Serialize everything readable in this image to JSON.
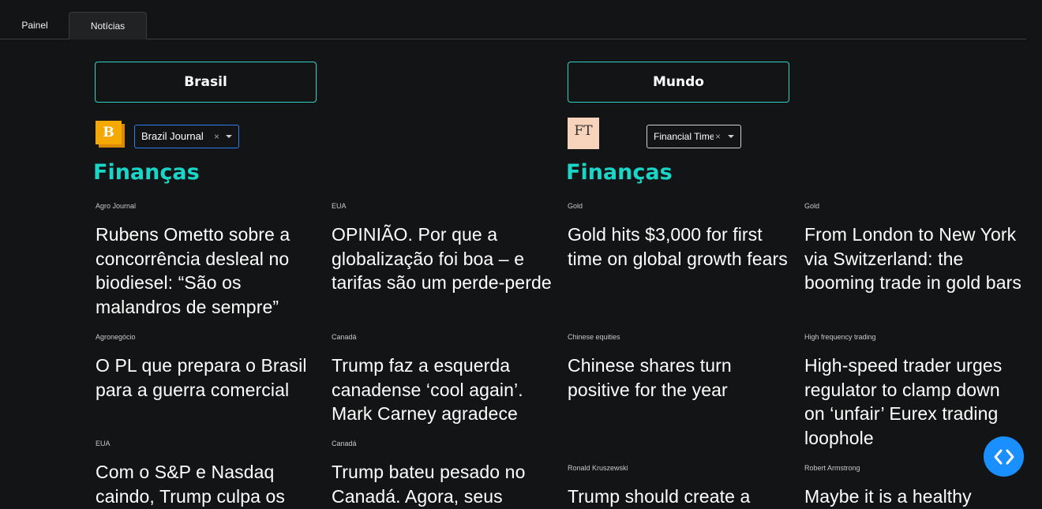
{
  "tabs": [
    {
      "label": "Painel"
    },
    {
      "label": "Notícias"
    }
  ],
  "brasil": {
    "region_label": "Brasil",
    "source_logo_letter": "B",
    "source_select": {
      "value": "Brazil Journal",
      "clear": "×"
    },
    "section_title": "Finanças",
    "columns": [
      [
        {
          "category": "Agro Journal",
          "title": "Rubens Ometto sobre a concorrência desleal no biodiesel: “São os malandros de sempre”"
        },
        {
          "category": "Agronegócio",
          "title": "O PL que prepara o Brasil para a guerra comercial"
        },
        {
          "category": "EUA",
          "title": "Com o S&P e Nasdaq caindo, Trump culpa os"
        }
      ],
      [
        {
          "category": "EUA",
          "title": "OPINIÃO. Por que a globalização foi boa – e tarifas são um perde-perde"
        },
        {
          "category": "Canadá",
          "title": "Trump faz a esquerda canadense ‘cool again’. Mark Carney agradece"
        },
        {
          "category": "Canadá",
          "title": "Trump bateu pesado no Canadá. Agora, seus"
        }
      ]
    ]
  },
  "mundo": {
    "region_label": "Mundo",
    "source_logo_text": "FT",
    "source_select": {
      "value": "Financial Times",
      "clear": "×"
    },
    "section_title": "Finanças",
    "columns": [
      [
        {
          "category": "Gold",
          "title": "Gold hits $3,000 for first time on global growth fears"
        },
        {
          "category": "Chinese equities",
          "title": "Chinese shares turn positive for the year"
        },
        {
          "category": "Ronald Kruszewski",
          "title": "Trump should create a"
        }
      ],
      [
        {
          "category": "Gold",
          "title": "From London to New York via Switzerland: the booming trade in gold bars"
        },
        {
          "category": "High frequency trading",
          "title": "High-speed trader urges regulator to clamp down on ‘unfair’ Eurex trading loophole"
        },
        {
          "category": "Robert Armstrong",
          "title": "Maybe it is a healthy"
        }
      ]
    ]
  },
  "colors": {
    "background": "#131415",
    "accent": "#19d6c8",
    "region_border": "#2fd2c9",
    "fab": "#1a8fff"
  },
  "fab_icon": "code-arrows-icon"
}
